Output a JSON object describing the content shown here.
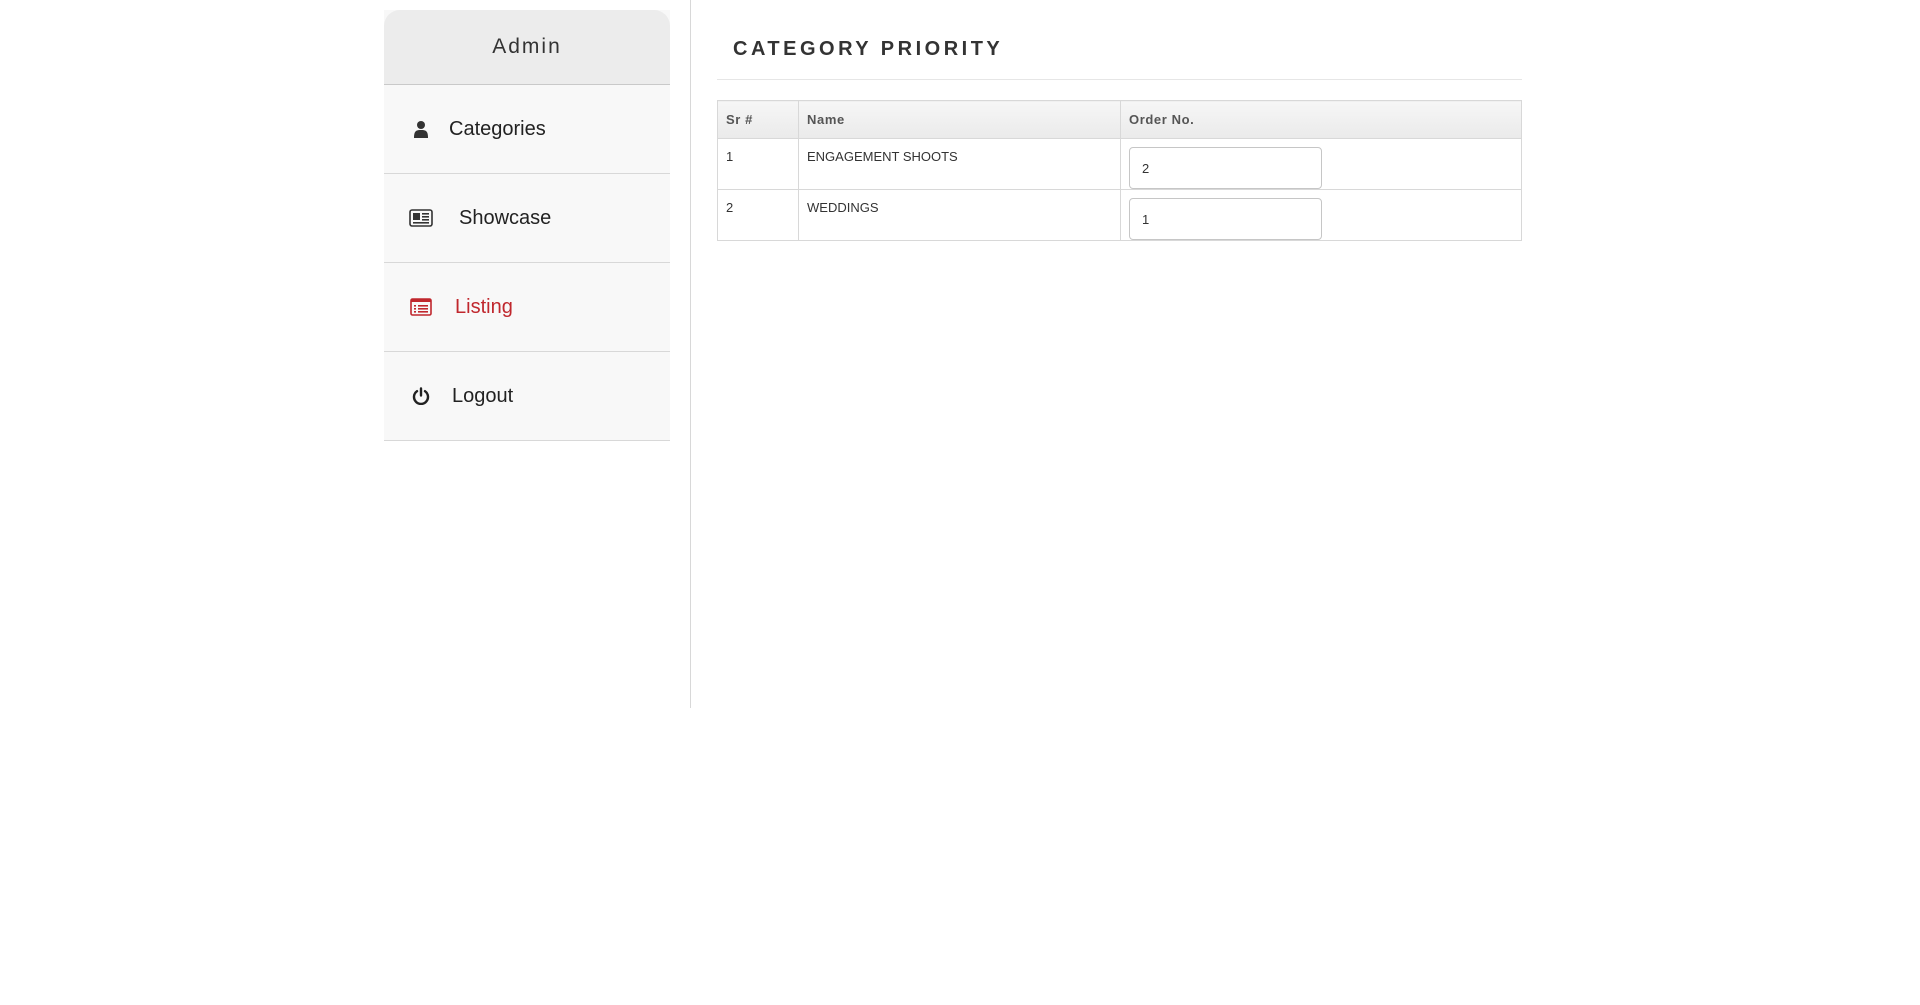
{
  "sidebar": {
    "title": "Admin",
    "items": [
      {
        "label": "Categories",
        "icon": "user-icon",
        "active": false
      },
      {
        "label": "Showcase",
        "icon": "newspaper-icon",
        "active": false
      },
      {
        "label": "Listing",
        "icon": "list-alt-icon",
        "active": true
      },
      {
        "label": "Logout",
        "icon": "power-icon",
        "active": false
      }
    ]
  },
  "main": {
    "title": "CATEGORY PRIORITY",
    "table": {
      "headers": [
        "Sr #",
        "Name",
        "Order No."
      ],
      "rows": [
        {
          "sr": "1",
          "name": "ENGAGEMENT SHOOTS",
          "order": "2"
        },
        {
          "sr": "2",
          "name": "WEDDINGS",
          "order": "1"
        }
      ]
    }
  },
  "colors": {
    "accent": "#c0272d",
    "sidebar_bg": "#f8f8f8",
    "sidebar_header_bg": "#ececec"
  }
}
